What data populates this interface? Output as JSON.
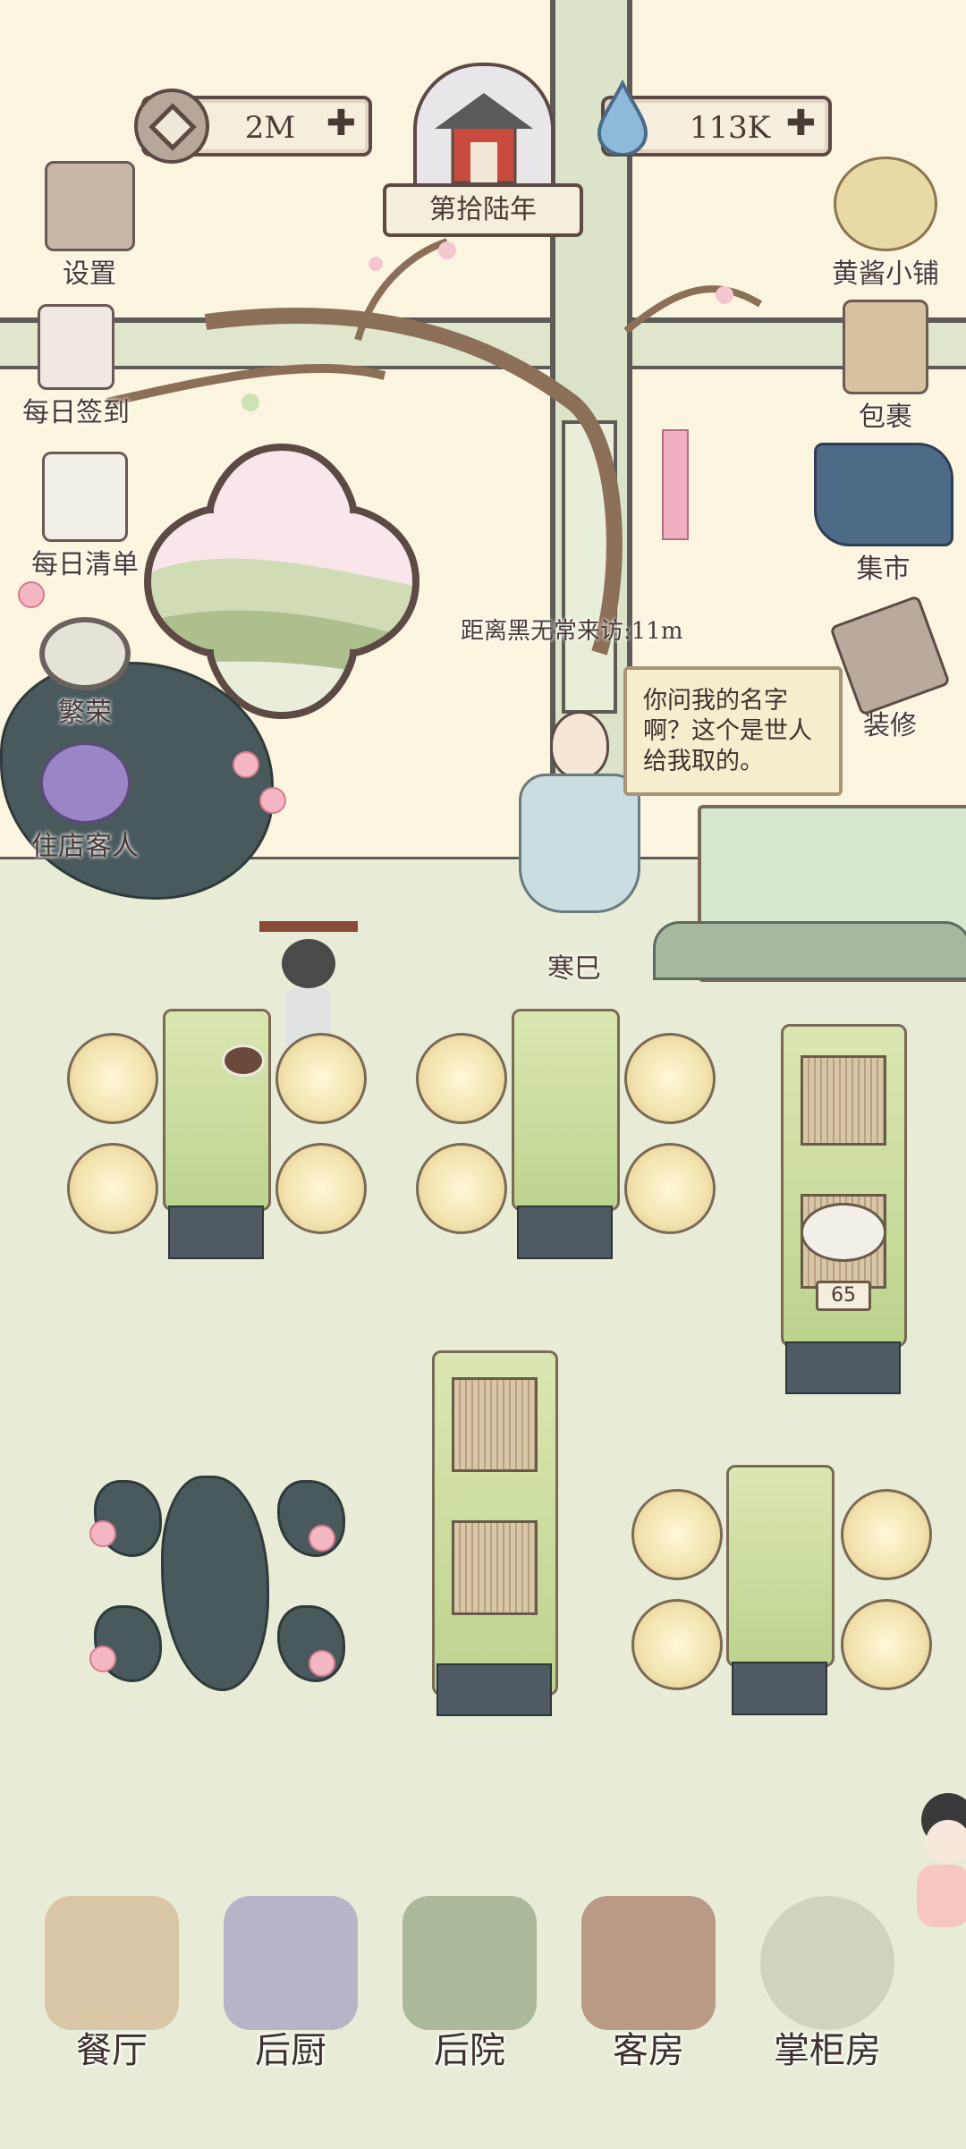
{
  "hud": {
    "coins": "2M",
    "jade": "113K",
    "year": "第拾陆年"
  },
  "left_menu": [
    {
      "label": "设置",
      "icon": "settings-box-icon"
    },
    {
      "label": "每日签到",
      "icon": "daily-checkin-icon"
    },
    {
      "label": "每日清单",
      "icon": "daily-list-icon"
    },
    {
      "label": "繁荣",
      "icon": "prosperity-icon"
    },
    {
      "label": "住店客人",
      "icon": "hotel-guests-icon"
    }
  ],
  "right_menu": [
    {
      "label": "黄酱小铺",
      "icon": "shop-icon"
    },
    {
      "label": "包裹",
      "icon": "bag-icon"
    },
    {
      "label": "集市",
      "icon": "market-icon"
    },
    {
      "label": "装修",
      "icon": "decorate-icon"
    }
  ],
  "event_text": "距离黑无常来访:11m",
  "npc": {
    "name": "寒巳",
    "dialog": "你问我的名字啊？这个是世人给我取的。"
  },
  "order_number": "65",
  "bottom_nav": [
    {
      "label": "餐厅"
    },
    {
      "label": "后厨"
    },
    {
      "label": "后院"
    },
    {
      "label": "客房"
    },
    {
      "label": "掌柜房"
    }
  ],
  "colors": {
    "wall": "#fbf5df",
    "floor": "#e8ecd6",
    "ink": "#4a3a36",
    "table_green": "#c6d99a",
    "blossom": "#f3b6c2"
  }
}
